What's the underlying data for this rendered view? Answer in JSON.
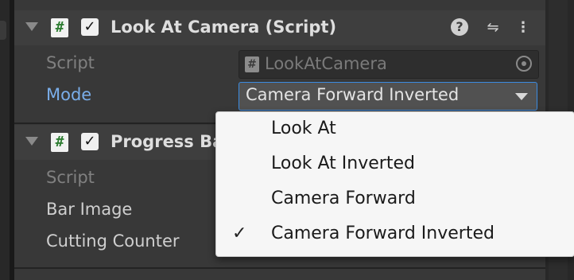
{
  "component1": {
    "title": "Look At Camera (Script)",
    "icon": "csharp-script-icon",
    "enabled_checkmark": "✓",
    "header_buttons": {
      "help": "?",
      "presets": "⇋",
      "menu": "⋮"
    },
    "fields": [
      {
        "label": "Script",
        "value": "LookAtCamera"
      },
      {
        "label": "Mode",
        "value": "Camera Forward Inverted"
      }
    ]
  },
  "component2": {
    "title": "Progress Ba",
    "enabled_checkmark": "✓",
    "fields": [
      {
        "label": "Script"
      },
      {
        "label": "Bar Image"
      },
      {
        "label": "Cutting Counter"
      }
    ]
  },
  "dropdown": {
    "items": [
      {
        "label": "Look At",
        "selected": false,
        "mark": ""
      },
      {
        "label": "Look At Inverted",
        "selected": false,
        "mark": ""
      },
      {
        "label": "Camera Forward",
        "selected": false,
        "mark": ""
      },
      {
        "label": "Camera Forward Inverted",
        "selected": true,
        "mark": "✓"
      }
    ]
  },
  "colors": {
    "panel": "#383838",
    "header": "#3e3e3e",
    "active_label": "#7aaeea",
    "focus_border": "#3b8be0",
    "menu_bg": "#f6f6f6"
  }
}
